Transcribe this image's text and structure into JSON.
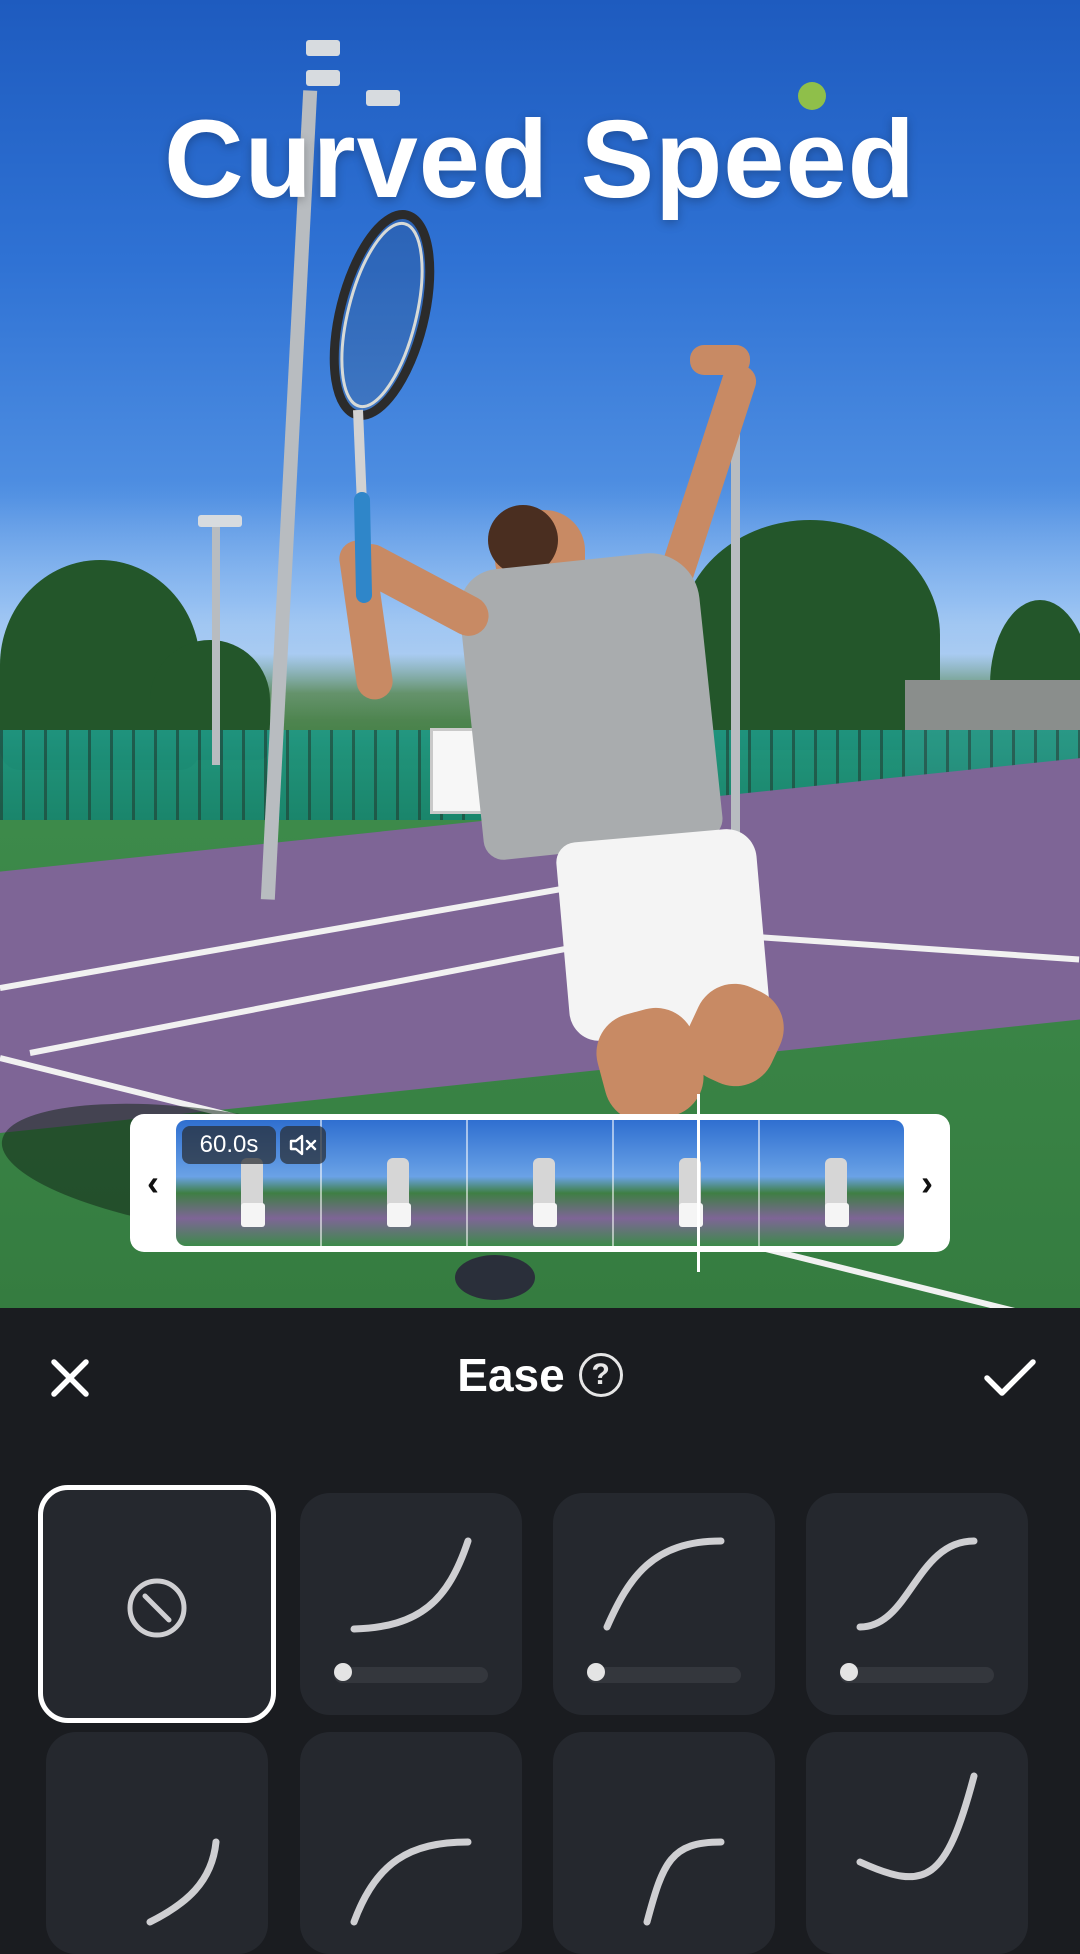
{
  "preview": {
    "title": "Curved Speed"
  },
  "timeline": {
    "duration": "60.0s",
    "mute_icon": "speaker-muted-icon",
    "prev_arrow": "‹",
    "next_arrow": "›"
  },
  "panel": {
    "title": "Ease",
    "help_glyph": "?",
    "close_icon": "close-icon",
    "confirm_icon": "checkmark-icon"
  },
  "presets": [
    {
      "name": "none",
      "icon": "no-effect-icon",
      "selected": true
    },
    {
      "name": "ease-in",
      "icon": "ease-in-curve-icon",
      "selected": false,
      "slider_value": 0
    },
    {
      "name": "ease-out",
      "icon": "ease-out-curve-icon",
      "selected": false,
      "slider_value": 0
    },
    {
      "name": "ease-in-out",
      "icon": "ease-in-out-curve-icon",
      "selected": false,
      "slider_value": 0
    },
    {
      "name": "preset-5",
      "icon": "curve-icon",
      "selected": false
    },
    {
      "name": "preset-6",
      "icon": "curve-icon",
      "selected": false
    },
    {
      "name": "preset-7",
      "icon": "curve-icon",
      "selected": false
    },
    {
      "name": "preset-8",
      "icon": "curve-icon",
      "selected": false
    }
  ],
  "colors": {
    "panel_bg": "#1a1c20",
    "tile_bg": "#25282e",
    "curve": "#cfcfd2",
    "selected_border": "#ffffff"
  }
}
